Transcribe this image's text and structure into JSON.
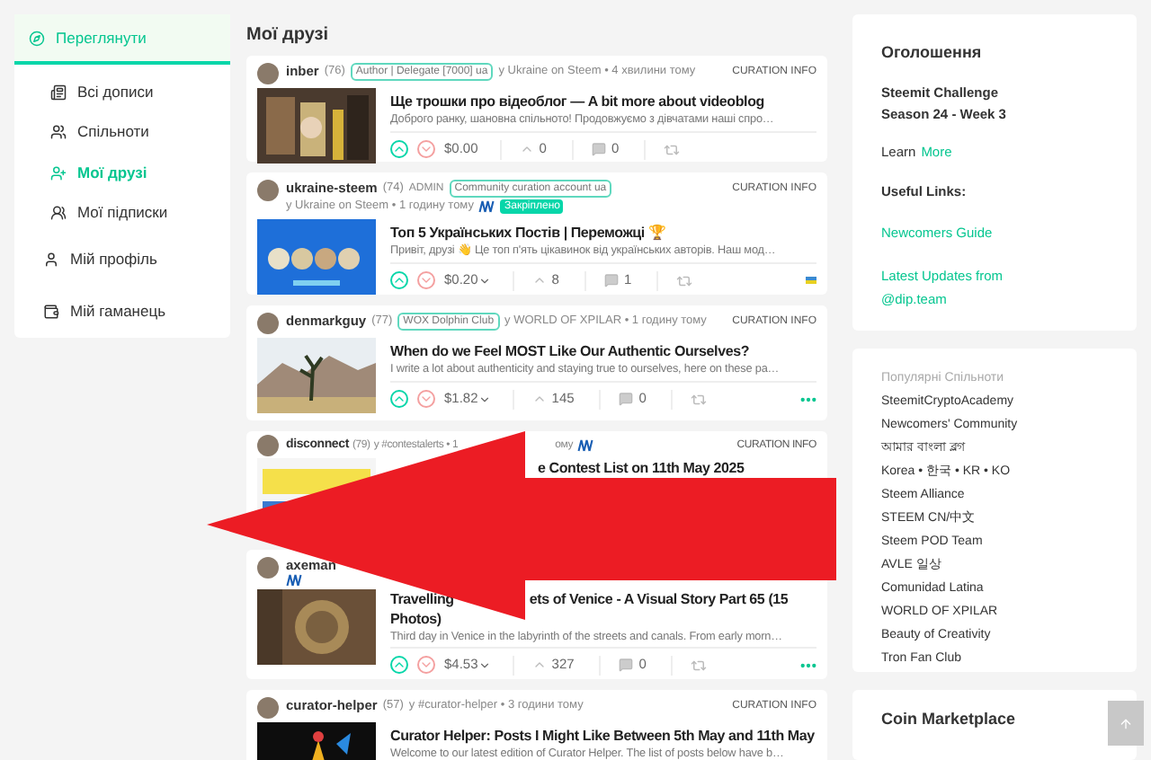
{
  "sidebar": {
    "tabs": [
      {
        "label": "Переглянути",
        "selected": true
      }
    ],
    "items": [
      {
        "kind": "sub",
        "label": "Всі дописи",
        "selected": false
      },
      {
        "kind": "sub",
        "label": "Спільноти",
        "selected": false
      },
      {
        "kind": "sub",
        "label": "Мої друзі",
        "selected": true
      },
      {
        "kind": "sub",
        "label": "Мої підписки",
        "selected": false
      },
      {
        "kind": "main",
        "label": "Мій профіль",
        "selected": false
      },
      {
        "kind": "main",
        "label": "Мій гаманець",
        "selected": false
      }
    ]
  },
  "feed": {
    "title": "Мої друзі",
    "posts": [
      {
        "author": "inber",
        "reputation": "(76)",
        "badge": "Author | Delegate [7000] ua",
        "meta": "у Ukraine on Steem • 4 хвилини тому",
        "curation": "CURATION INFO",
        "title": "Ще трошки про відеоблог — A bit more about videoblog",
        "excerpt": "Доброго ранку, шановна спільното! Продовжуємо з дівчатами наші спро…",
        "payout": "$0.00",
        "payout_menu": false,
        "votes": "0",
        "comments": "0",
        "more_menu": false,
        "flag": false
      },
      {
        "author": "ukraine-steem",
        "reputation": "(74)",
        "role": "ADMIN",
        "badge": "Community curation account ua",
        "meta": "у Ukraine on Steem • 1 годину тому",
        "steem_mark": true,
        "pinned": "Закріплено",
        "curation": "CURATION INFO",
        "title": "Топ 5 Українських Постів | Переможці 🏆",
        "excerpt": "Привіт, друзі 👋 Це топ п'ять цікавинок від українських авторів. Наш мод…",
        "payout": "$0.20",
        "payout_menu": true,
        "votes": "8",
        "comments": "1",
        "more_menu": false,
        "flag": true
      },
      {
        "author": "denmarkguy",
        "reputation": "(77)",
        "badge": "WOX Dolphin Club",
        "meta": "у WORLD OF XPILAR • 1 годину тому",
        "curation": "CURATION INFO",
        "title": "When do we Feel MOST Like Our Authentic Ourselves?",
        "excerpt": "I write a lot about authenticity and staying true to ourselves, here on these pa…",
        "payout": "$1.82",
        "payout_menu": true,
        "votes": "145",
        "comments": "0",
        "more_menu": true,
        "flag": false
      }
    ],
    "covered_post": {
      "author": "disconnect",
      "reputation": "(79)",
      "meta": "у #contestalerts • 1",
      "meta_tail": "ому",
      "curation": "CURATION INFO",
      "title_tail": "e Contest List on 11th May 2025"
    },
    "covered_post_2": {
      "author": "axeman",
      "title_head": "Travelling",
      "title_tail": "ets of Venice - A Visual Story Part 65 (15",
      "title_line2": "Photos)",
      "excerpt": "Third day in Venice in the labyrinth of the streets and canals. From early morn…",
      "payout": "$4.53",
      "payout_menu": true,
      "votes": "327",
      "comments": "0",
      "more_menu": true,
      "flag": false
    },
    "last_post": {
      "author": "curator-helper",
      "reputation": "(57)",
      "meta": "у #curator-helper • 3 години тому",
      "curation": "CURATION INFO",
      "title": "Curator Helper: Posts I Might Like Between 5th May and 11th May",
      "excerpt": "Welcome to our latest edition of Curator Helper. The list of posts below have b…"
    }
  },
  "announcements": {
    "title": "Оголошення",
    "headline": "Steemit Challenge Season 24 - Week 3",
    "learn": "Learn",
    "learn_link": "More",
    "links_title": "Useful Links:",
    "links": [
      "Newcomers Guide",
      "Latest Updates from @dip.team"
    ]
  },
  "communities": {
    "title": "Популярні Спільноти",
    "items": [
      "SteemitCryptoAcademy",
      "Newcomers' Community",
      "আমার বাংলা ব্লগ",
      "Korea • 한국 • KR • KO",
      "Steem Alliance",
      "STEEM CN/中文",
      "Steem POD Team",
      "AVLE 일상",
      "Comunidad Latina",
      "WORLD OF XPILAR",
      "Beauty of Creativity",
      "Tron Fan Club"
    ]
  },
  "marketplace": {
    "title": "Coin Marketplace"
  }
}
